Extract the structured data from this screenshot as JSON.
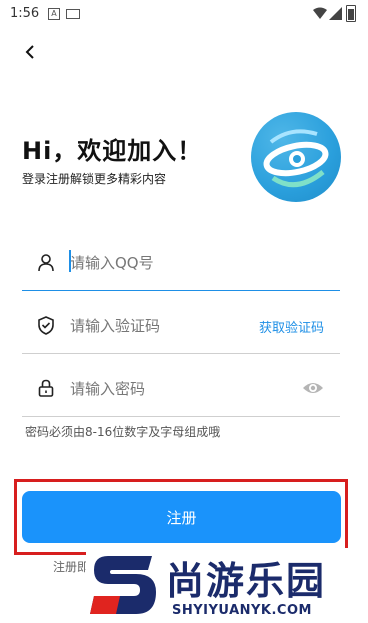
{
  "status_bar": {
    "time": "1:56",
    "notif_a": "A"
  },
  "header": {
    "back_icon": "back-arrow-icon"
  },
  "hero": {
    "title": "Hi，欢迎加入！",
    "subtitle": "登录注册解锁更多精彩内容"
  },
  "form": {
    "qq": {
      "placeholder": "请输入QQ号",
      "value": ""
    },
    "code": {
      "placeholder": "请输入验证码",
      "value": "",
      "get_code_label": "获取验证码"
    },
    "password": {
      "placeholder": "请输入密码",
      "value": ""
    },
    "hint": "密码必须由8-16位数字及字母组成哦"
  },
  "register_button": {
    "label": "注册"
  },
  "agreement_partial": "注册即",
  "watermark": {
    "title": "尚游乐园",
    "url": "SHYIYUANYK.COM"
  },
  "colors": {
    "accent": "#1e8fe6",
    "button": "#1a93fb",
    "highlight": "#d71e1e",
    "watermark": "#1b2b6b"
  }
}
